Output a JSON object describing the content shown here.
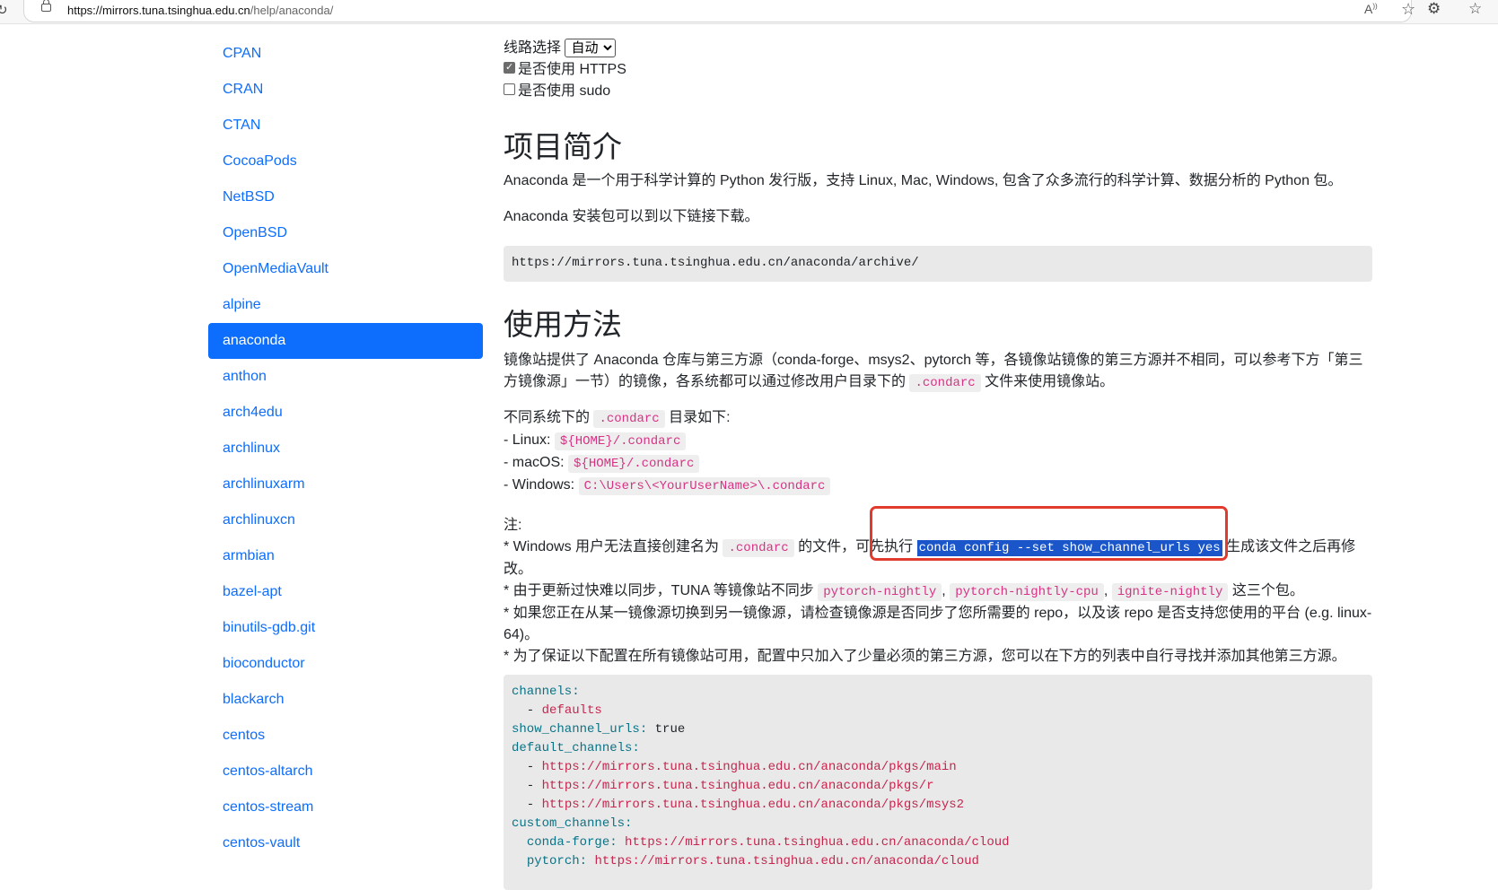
{
  "browser": {
    "url_host": "https://mirrors.tuna.tsinghua.edu.cn",
    "url_path": "/help/anaconda/",
    "icons": [
      "reload-icon",
      "lock-icon",
      "read-aloud-icon",
      "favorite-star-icon",
      "extensions-icon",
      "favorites-icon"
    ]
  },
  "sidebar": {
    "active_index": 8,
    "items": [
      "CPAN",
      "CRAN",
      "CTAN",
      "CocoaPods",
      "NetBSD",
      "OpenBSD",
      "OpenMediaVault",
      "alpine",
      "anaconda",
      "anthon",
      "arch4edu",
      "archlinux",
      "archlinuxarm",
      "archlinuxcn",
      "armbian",
      "bazel-apt",
      "binutils-gdb.git",
      "bioconductor",
      "blackarch",
      "centos",
      "centos-altarch",
      "centos-stream",
      "centos-vault"
    ]
  },
  "options": {
    "route_label": "线路选择",
    "route_value": "自动",
    "https_label": "是否使用 HTTPS",
    "https_checked": true,
    "sudo_label": "是否使用 sudo",
    "sudo_checked": false
  },
  "intro": {
    "heading": "项目简介",
    "p1": "Anaconda 是一个用于科学计算的 Python 发行版，支持 Linux, Mac, Windows, 包含了众多流行的科学计算、数据分析的 Python 包。",
    "p2": "Anaconda 安装包可以到以下链接下载。",
    "archive_url": "https://mirrors.tuna.tsinghua.edu.cn/anaconda/archive/"
  },
  "usage": {
    "heading": "使用方法",
    "p1_line1": "镜像站提供了 Anaconda 仓库与第三方源（conda-forge、msys2、pytorch 等，各镜像站镜像的第三方源并不相同，可以参考下方「第三",
    "p1_line2a": "方镜像源」一节）的镜像，各系统都可以通过修改用户目录下的",
    "p1_code": ".condarc",
    "p1_line2b": "文件来使用镜像站。",
    "dirs_a": "不同系统下的",
    "dirs_code": ".condarc",
    "dirs_b": "目录如下:",
    "linux_label": "- Linux:",
    "linux_path": "${HOME}/.condarc",
    "mac_label": "- macOS:",
    "mac_path": "${HOME}/.condarc",
    "win_label": "- Windows:",
    "win_path": "C:\\Users\\<YourUserName>\\.condarc",
    "note_label": "注:",
    "note1_a": "* Windows 用户无法直接创建名为",
    "note1_code": ".condarc",
    "note1_b": "的文件，可先执行",
    "note1_cmd": "conda config --set show_channel_urls yes",
    "note1_c": "生成该文件之后再修",
    "note1_d": "改。",
    "note2_a": "* 由于更新过快难以同步，TUNA 等镜像站不同步",
    "note2_code1": "pytorch-nightly",
    "note2_code2": "pytorch-nightly-cpu",
    "note2_code3": "ignite-nightly",
    "note2_b": "这三个包。",
    "note2_sep": ",",
    "note3_line1": "* 如果您正在从某一镜像源切换到另一镜像源，请检查镜像源是否同步了您所需要的 repo，以及该 repo 是否支持您使用的平台 (e.g. linux-",
    "note3_line2": "64)。",
    "note4": "* 为了保证以下配置在所有镜像站可用，配置中只加入了少量必须的第三方源，您可以在下方的列表中自行寻找并添加其他第三方源。"
  },
  "config": {
    "channels_key": "channels:",
    "defaults_item": "defaults",
    "show_key": "show_channel_urls:",
    "show_val": "true",
    "default_channels_key": "default_channels:",
    "dc1": "https://mirrors.tuna.tsinghua.edu.cn/anaconda/pkgs/main",
    "dc2": "https://mirrors.tuna.tsinghua.edu.cn/anaconda/pkgs/r",
    "dc3": "https://mirrors.tuna.tsinghua.edu.cn/anaconda/pkgs/msys2",
    "custom_key": "custom_channels:",
    "cf_key": "conda-forge:",
    "cf_val": "https://mirrors.tuna.tsinghua.edu.cn/anaconda/cloud",
    "pt_key": "pytorch:",
    "pt_val": "https://mirrors.tuna.tsinghua.edu.cn/anaconda/cloud"
  }
}
